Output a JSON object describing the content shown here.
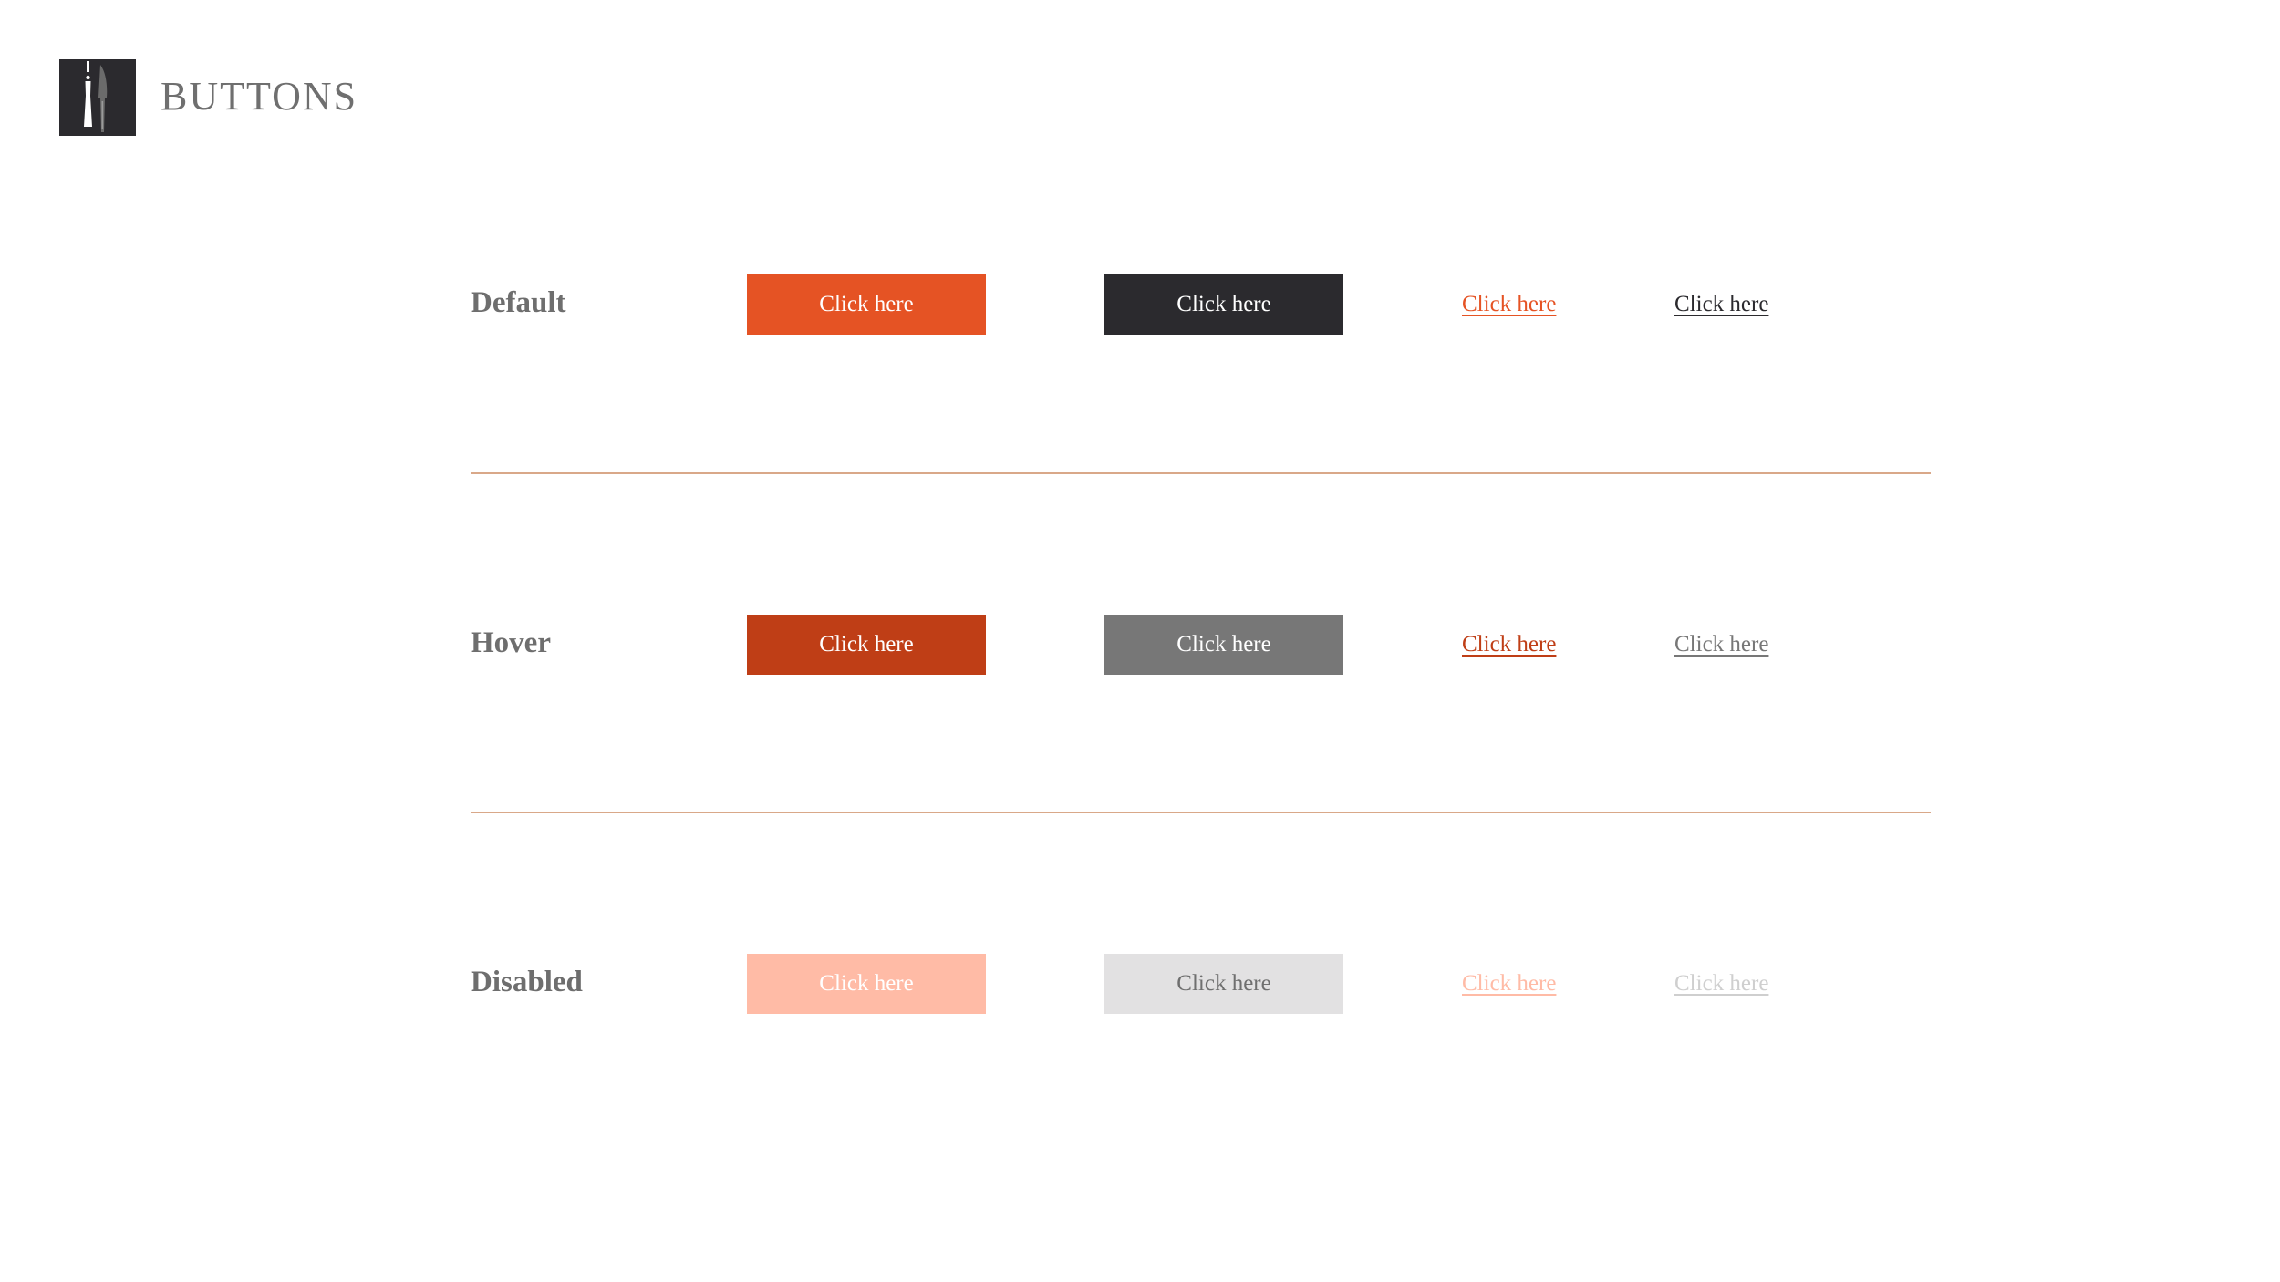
{
  "header": {
    "title": "BUTTONS",
    "logo_icon": "fork-knife-icon"
  },
  "colors": {
    "primary": "#e55324",
    "primary_hover": "#bf3e16",
    "primary_disabled": "#ffbba6",
    "secondary": "#2b2a2e",
    "secondary_hover": "#777777",
    "secondary_disabled": "#e2e1e2",
    "divider": "#d9a889",
    "label": "#6e6e6e"
  },
  "rows": [
    {
      "label": "Default",
      "primary_button": "Click here",
      "secondary_button": "Click here",
      "primary_link": "Click here",
      "secondary_link": "Click here"
    },
    {
      "label": "Hover",
      "primary_button": "Click here",
      "secondary_button": "Click here",
      "primary_link": "Click here",
      "secondary_link": "Click here"
    },
    {
      "label": "Disabled",
      "primary_button": "Click here",
      "secondary_button": "Click here",
      "primary_link": "Click here",
      "secondary_link": "Click here"
    }
  ]
}
